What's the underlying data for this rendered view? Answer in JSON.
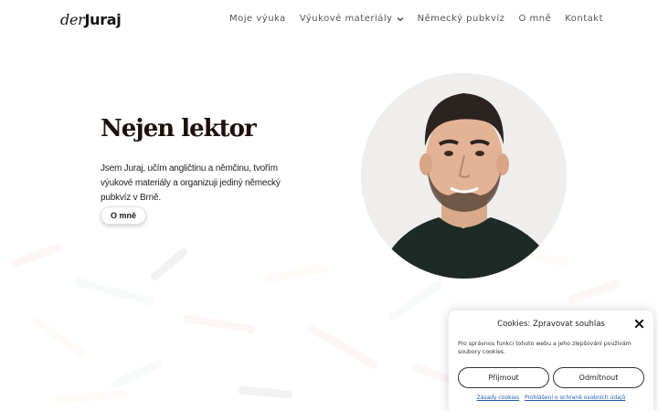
{
  "header": {
    "logo_prefix": "der",
    "logo_main": "Juraj",
    "nav": [
      {
        "label": "Moje výuka"
      },
      {
        "label": "Výukové materiály"
      },
      {
        "label": "Německý pubkvíz"
      },
      {
        "label": "O mně"
      },
      {
        "label": "Kontakt"
      }
    ]
  },
  "hero": {
    "title": "Nejen lektor",
    "text": "Jsem Juraj, učím angličtinu a němčinu, tvořím výukové materiály a organizuji jediný německý pubkvíz v Brně.",
    "button_label": "O mně"
  },
  "cookie": {
    "title": "Cookies: Zpravovat souhlas",
    "text": "Pro správnou funkci tohoto webu a jeho zlepšování používám soubory cookies.",
    "accept_label": "Přijmout",
    "decline_label": "Odmítnout",
    "link_policy": "Zásady cookies",
    "link_privacy": "Prohlášení o ochraně osobních údajů"
  },
  "colors": {
    "title": "#1e0f0a",
    "nav_text": "#555555",
    "link": "#1e5fb4"
  }
}
